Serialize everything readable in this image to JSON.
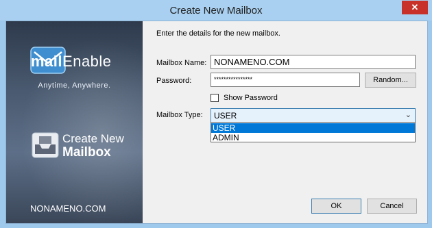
{
  "window": {
    "title": "Create New Mailbox",
    "close_glyph": "✕"
  },
  "sidebar": {
    "logo_part1": "mail",
    "logo_part2": "Enable",
    "tagline": "Anytime, Anywhere.",
    "heading_line1": "Create New",
    "heading_line2": "Mailbox",
    "footer": "NONAMENO.COM"
  },
  "form": {
    "intro": "Enter the details for the new mailbox.",
    "mailbox_name_label": "Mailbox Name:",
    "mailbox_name_value": "NONAMENO.COM",
    "password_label": "Password:",
    "password_value": "****************",
    "random_button": "Random...",
    "show_password_label": "Show Password",
    "show_password_checked": false,
    "mailbox_type_label": "Mailbox Type:",
    "mailbox_type_value": "USER",
    "mailbox_type_options": [
      "USER",
      "ADMIN"
    ]
  },
  "buttons": {
    "ok": "OK",
    "cancel": "Cancel"
  },
  "colors": {
    "accent": "#0078d7",
    "titlebar": "#a9d0f0",
    "close": "#c7312a"
  }
}
